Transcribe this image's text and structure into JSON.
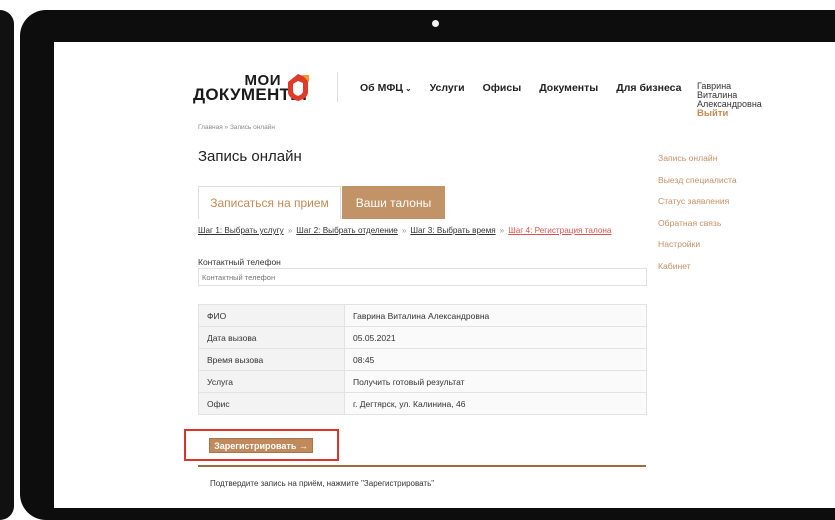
{
  "logo": {
    "line1": "МОИ",
    "line2": "ДОКУМЕНТЫ"
  },
  "nav": {
    "items": [
      "Об МФЦ",
      "Услуги",
      "Офисы",
      "Документы",
      "Для бизнеса"
    ],
    "caret": "⌄"
  },
  "user": {
    "last_name": "Гаврина",
    "first_name": "Виталина",
    "patronymic": "Александровна",
    "logout": "Выйти"
  },
  "breadcrumb": "Главная » Запись онлайн",
  "page_title": "Запись онлайн",
  "tabs": {
    "book": "Записаться на прием",
    "tickets": "Ваши талоны"
  },
  "steps": {
    "step1": "Шаг 1: Выбрать услугу",
    "step2": "Шаг 2: Выбрать отделение",
    "step3": "Шаг 3: Выбрать время",
    "step4": "Шаг 4: Регистрация талона",
    "separator": "»"
  },
  "phone": {
    "label": "Контактный телефон",
    "placeholder": "Контактный телефон",
    "value": ""
  },
  "details": [
    {
      "key": "ФИО",
      "value": "Гаврина Виталина Александровна"
    },
    {
      "key": "Дата вызова",
      "value": "05.05.2021"
    },
    {
      "key": "Время вызова",
      "value": "08:45"
    },
    {
      "key": "Услуга",
      "value": "Получить готовый результат"
    },
    {
      "key": "Офис",
      "value": "г. Дегтярск, ул. Калинина, 46"
    }
  ],
  "register_button": "Зарегистрировать →",
  "confirm_text": "Подтвердите запись на приём, нажмите \"Зарегистрировать\"",
  "sidebar": {
    "items": [
      "Запись онлайн",
      "Выезд специалиста",
      "Статус заявления",
      "Обратная связь",
      "Настройки",
      "Кабинет"
    ]
  },
  "colors": {
    "accent": "#c48a54",
    "tab_bg": "#c39368",
    "highlight_red": "#d9352a",
    "logo_red": "#e03a2b",
    "logo_orange": "#f09a2a"
  }
}
